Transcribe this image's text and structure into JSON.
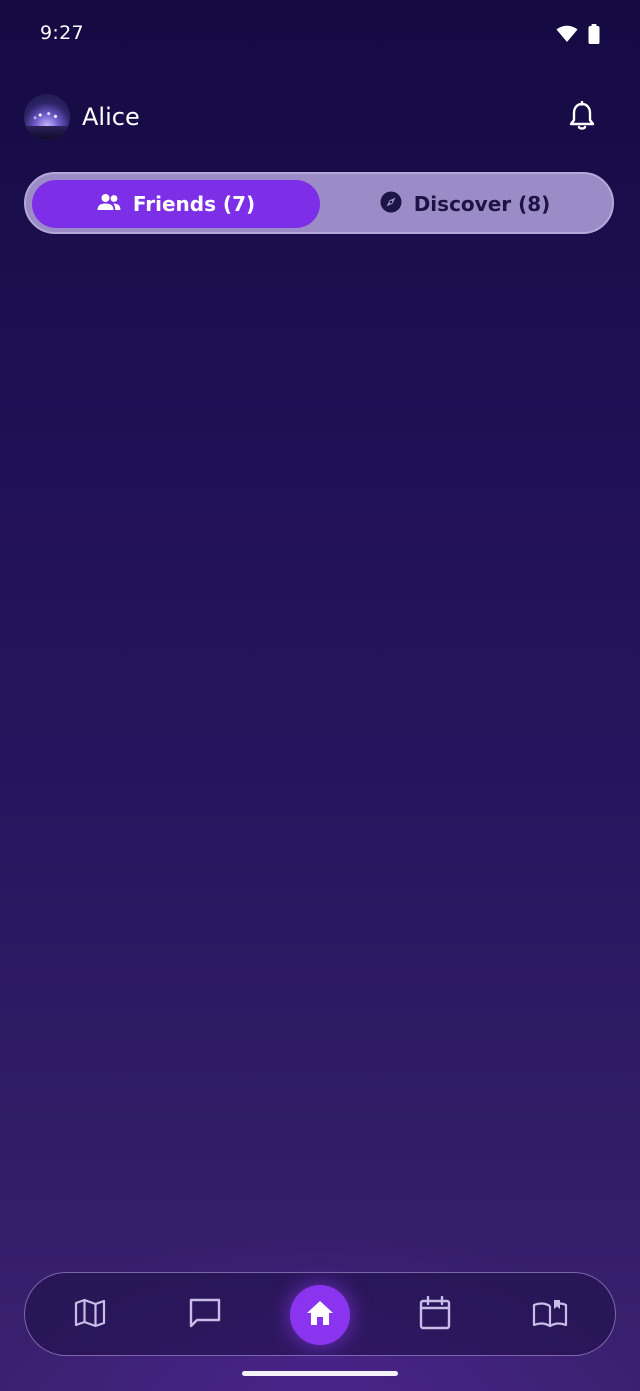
{
  "status_bar": {
    "time": "9:27",
    "icons": [
      "wifi-icon",
      "battery-icon"
    ]
  },
  "header": {
    "user_name": "Alice",
    "avatar": "avatar-concert-photo",
    "notifications_icon": "bell-icon"
  },
  "segment": {
    "friends": {
      "label": "Friends (7)",
      "icon": "people-icon",
      "selected": true
    },
    "discover": {
      "label": "Discover (8)",
      "icon": "compass-icon",
      "selected": false
    }
  },
  "bottom_nav": {
    "items": [
      {
        "icon": "map-icon",
        "active": false
      },
      {
        "icon": "chat-icon",
        "active": false
      },
      {
        "icon": "home-icon",
        "active": true
      },
      {
        "icon": "calendar-icon",
        "active": false
      },
      {
        "icon": "book-icon",
        "active": false
      }
    ]
  },
  "colors": {
    "background_top": "#150a42",
    "background_bottom": "#3a2170",
    "accent": "#7c2fe6",
    "segment_bg": "#9b8bc6"
  }
}
